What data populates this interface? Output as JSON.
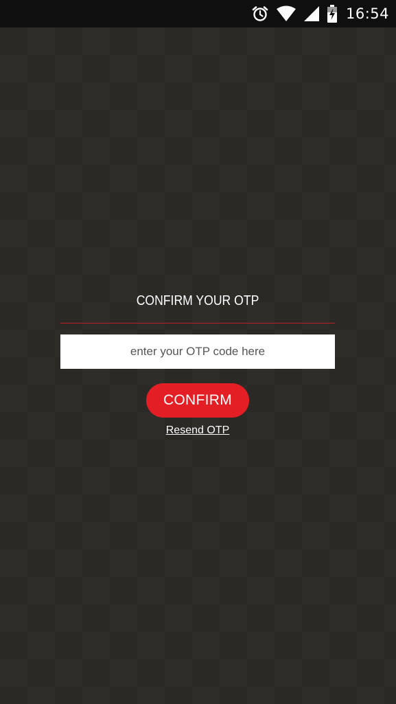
{
  "status_bar": {
    "time": "16:54",
    "icons": [
      "alarm-icon",
      "wifi-icon",
      "signal-icon",
      "battery-charging-icon"
    ]
  },
  "otp": {
    "title": "CONFIRM YOUR OTP",
    "input_placeholder": "enter your OTP code here",
    "input_value": "",
    "confirm_label": "CONFIRM",
    "resend_label": "Resend OTP"
  },
  "colors": {
    "background": "#2a2926",
    "status_bar": "#0f0f0f",
    "accent": "#e31e24",
    "divider": "#c0201f"
  }
}
